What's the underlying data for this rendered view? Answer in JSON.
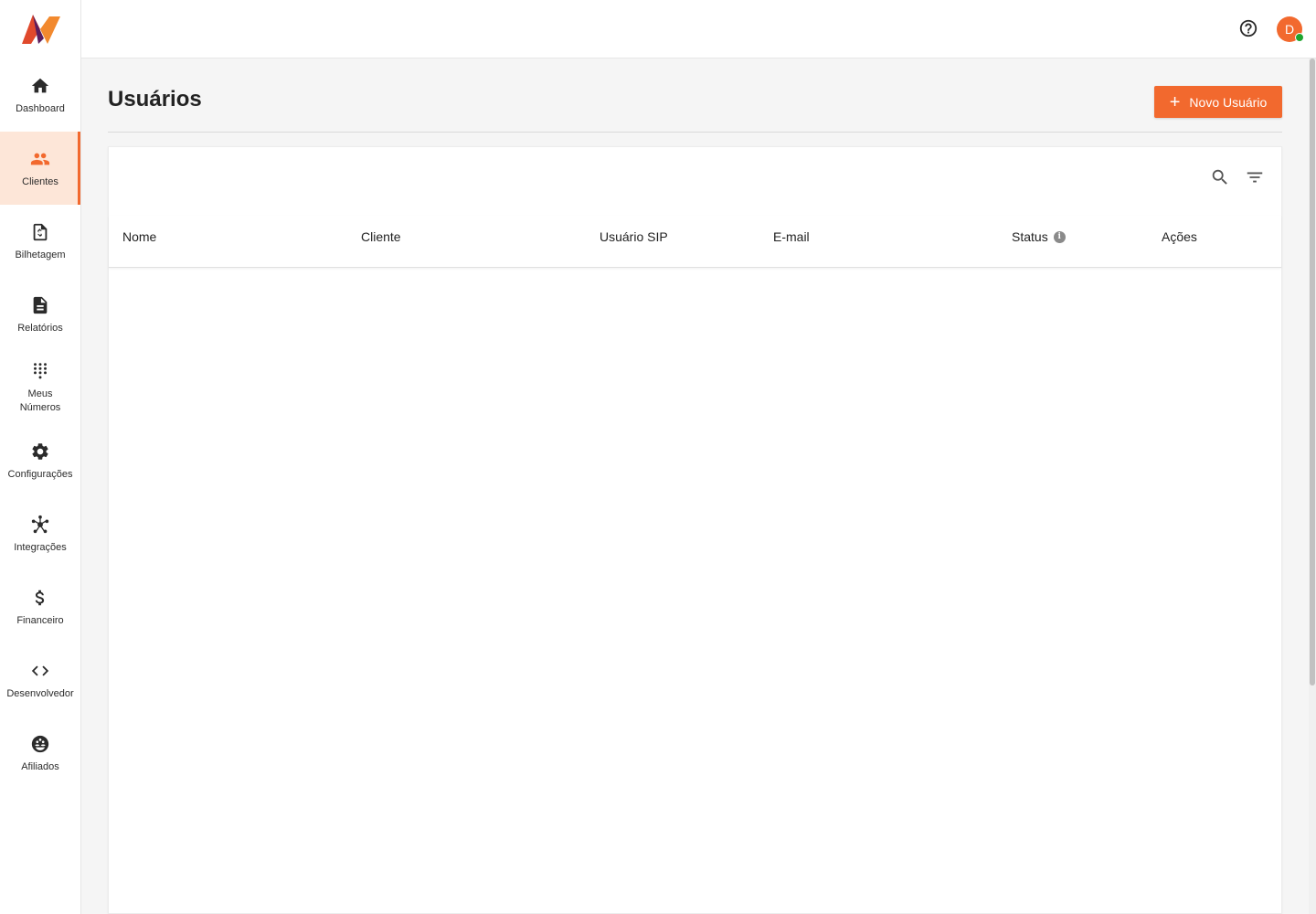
{
  "brand": {
    "accent": "#f2692e",
    "logo_icon": "brand-logo"
  },
  "sidebar": {
    "items": [
      {
        "label": "Dashboard",
        "icon": "home-icon"
      },
      {
        "label": "Clientes",
        "icon": "people-icon",
        "active": true
      },
      {
        "label": "Bilhetagem",
        "icon": "invoice-icon"
      },
      {
        "label": "Relatórios",
        "icon": "document-icon"
      },
      {
        "label": "Meus Números",
        "icon": "dialpad-icon"
      },
      {
        "label": "Configurações",
        "icon": "gear-icon"
      },
      {
        "label": "Integrações",
        "icon": "hub-icon"
      },
      {
        "label": "Financeiro",
        "icon": "dollar-icon"
      },
      {
        "label": "Desenvolvedor",
        "icon": "code-icon"
      },
      {
        "label": "Afiliados",
        "icon": "affiliates-icon"
      }
    ]
  },
  "topbar": {
    "avatar_initial": "D",
    "status_color": "#1ea52f"
  },
  "page": {
    "title": "Usuários",
    "new_button_label": "Novo Usuário"
  },
  "table": {
    "columns": [
      "Nome",
      "Cliente",
      "Usuário SIP",
      "E-mail",
      "Status",
      "Ações"
    ],
    "rows": []
  }
}
